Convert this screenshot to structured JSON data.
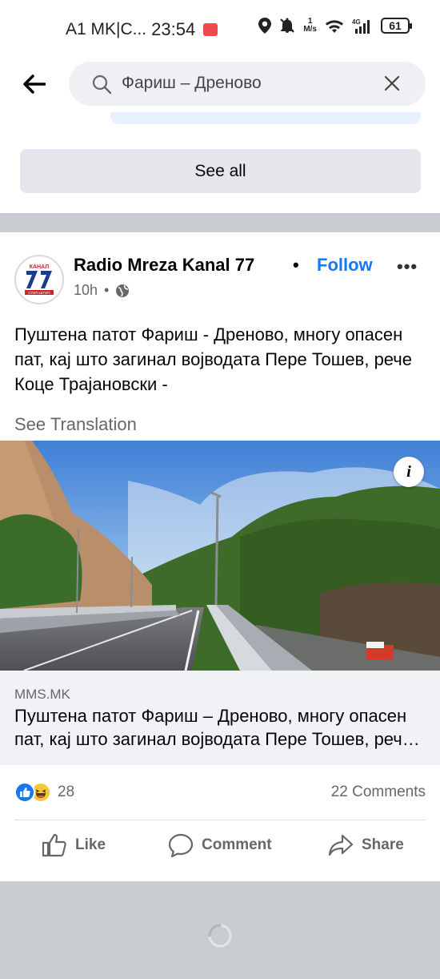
{
  "status_bar": {
    "carrier": "A1 MK|C...",
    "time": "23:54",
    "speed_value": "1",
    "speed_unit": "M/s",
    "network": "4G",
    "battery": "61"
  },
  "search": {
    "query": "Фариш – Дреново"
  },
  "see_all_label": "See all",
  "post": {
    "page_name": "Radio Mreza Kanal 77",
    "separator": "•",
    "follow_label": "Follow",
    "more_label": "•••",
    "time": "10h",
    "meta_separator": "•",
    "text": "Пуштена патот Фариш - Дреново, многу опасен пат, кај што загинал војводата Пере Тошев, рече Коце Трајановски -",
    "see_translation": "See Translation",
    "link": {
      "domain": "MMS.MK",
      "title": "Пуштена патот Фариш – Дреново, многу опасен пат, кај што загинал војводата Пере Тошев, рече Коце Трајановски"
    },
    "reaction_count": "28",
    "comments_label": "22 Comments",
    "actions": {
      "like": "Like",
      "comment": "Comment",
      "share": "Share"
    }
  },
  "avatar_logo": {
    "top_text": "КАНАЛ",
    "number": "77",
    "bottom_text": "СТИП·ШТИП"
  },
  "colors": {
    "accent": "#1877f2",
    "secondary_text": "#65676b",
    "divider_gray": "#c9ccd1"
  },
  "icons": [
    "back-arrow-icon",
    "search-icon",
    "clear-icon",
    "globe-icon",
    "info-icon",
    "like-icon",
    "comment-icon",
    "share-icon",
    "loading-spinner-icon"
  ]
}
